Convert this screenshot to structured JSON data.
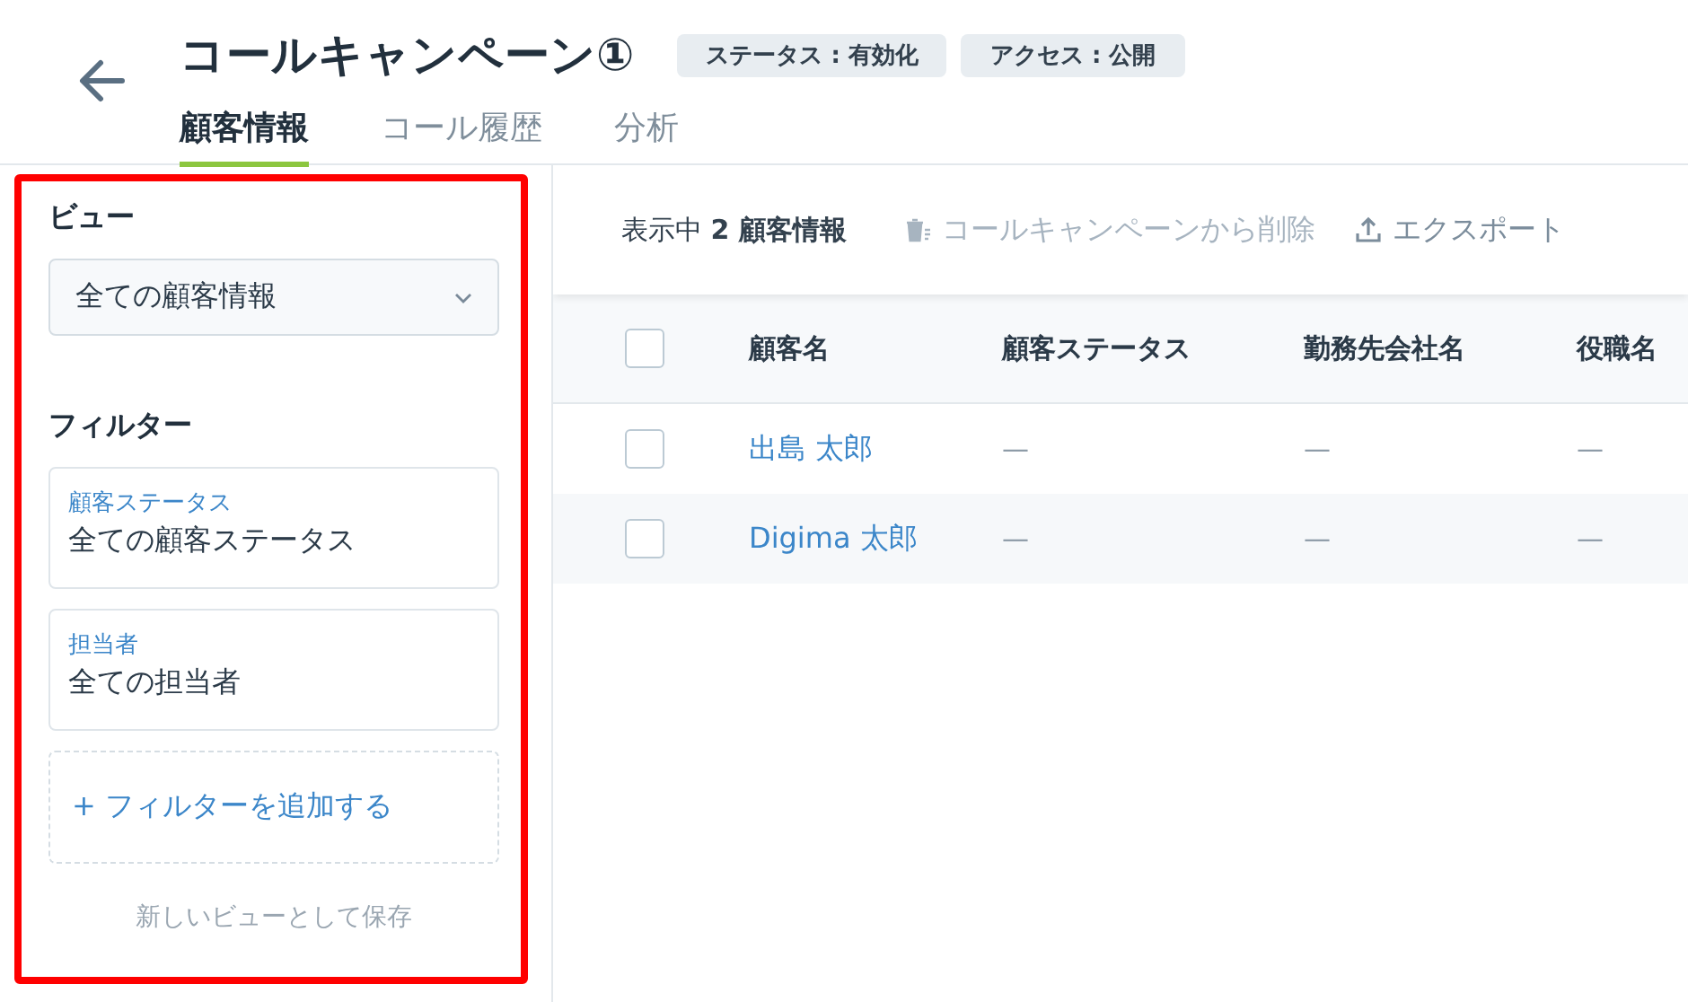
{
  "header": {
    "title": "コールキャンペーン①",
    "badges": [
      "ステータス : 有効化",
      "アクセス : 公開"
    ],
    "tabs": [
      {
        "label": "顧客情報",
        "selected": true
      },
      {
        "label": "コール履歴",
        "selected": false
      },
      {
        "label": "分析",
        "selected": false
      }
    ]
  },
  "sidebar": {
    "highlighted": true,
    "view_heading": "ビュー",
    "view_select": "全ての顧客情報",
    "filter_heading": "フィルター",
    "filters": [
      {
        "label": "顧客ステータス",
        "value": "全ての顧客ステータス"
      },
      {
        "label": "担当者",
        "value": "全ての担当者"
      }
    ],
    "add_filter": "+ フィルターを追加する",
    "save_view": "新しいビューとして保存"
  },
  "toolbar": {
    "count": "表示中 **2 顧客情報**",
    "actions": [
      {
        "kind": "delete",
        "label": "コールキャンペーンから削除"
      },
      {
        "kind": "export",
        "label": "エクスポート"
      }
    ]
  },
  "table": {
    "columns": [
      "顧客名",
      "顧客ステータス",
      "勤務先会社名",
      "役職名"
    ],
    "header_checked": false,
    "rows": [
      {
        "checked": false,
        "cells": [
          "出島 太郎",
          "—",
          "—",
          "—"
        ]
      },
      {
        "checked": false,
        "cells": [
          "Digima 太郎",
          "—",
          "—",
          "—"
        ]
      }
    ]
  }
}
